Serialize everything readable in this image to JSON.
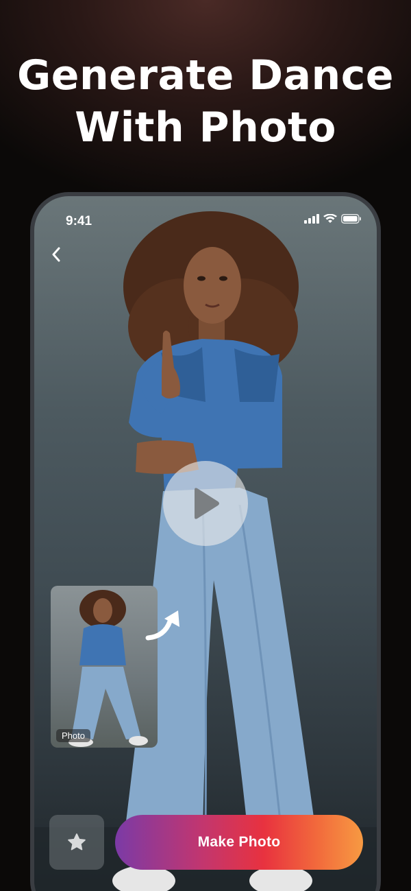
{
  "headline": {
    "line1": "Generate Dance",
    "line2": "With Photo"
  },
  "status_bar": {
    "time": "9:41",
    "icons": [
      "signal-icon",
      "wifi-icon",
      "battery-icon"
    ]
  },
  "nav": {
    "back_icon": "chevron-left-icon"
  },
  "video": {
    "play_icon": "play-icon"
  },
  "source_photo": {
    "label": "Photo"
  },
  "actions": {
    "favorite_icon": "star-icon",
    "make_photo_label": "Make Photo"
  },
  "colors": {
    "button_gradient": [
      "#7b3aa6",
      "#c2366f",
      "#e8323f",
      "#f26b3c",
      "#f79a42"
    ],
    "denim": "#3f74b3",
    "jeans": "#86a9cb",
    "hair": "#4a2a1a",
    "skin": "#8a5a3e"
  }
}
